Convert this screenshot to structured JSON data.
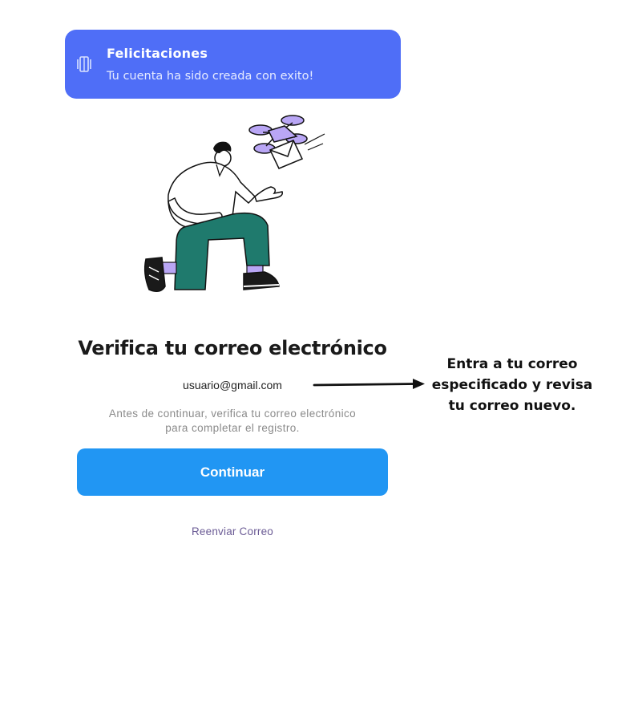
{
  "toast": {
    "icon": "vibrate-icon",
    "title": "Felicitaciones",
    "message": "Tu cuenta ha sido creada con exito!"
  },
  "illustration": {
    "icon": "person-receiving-drone-mail-illustration",
    "colors": {
      "drone": "#b9a6f5",
      "pants": "#1f7a6d",
      "outline": "#111111"
    }
  },
  "main": {
    "title": "Verifica tu correo electrónico",
    "email": "usuario@gmail.com",
    "instructions_line1": "Antes de continuar, verifica tu correo electrónico",
    "instructions_line2": "para completar el registro.",
    "continue_label": "Continuar",
    "resend_label": "Reenviar Correo"
  },
  "annotation": {
    "line1": "Entra a tu correo",
    "line2": "especificado y revisa",
    "line3": "tu correo nuevo."
  },
  "colors": {
    "toast_bg": "#4f6ef7",
    "button_bg": "#2196f3",
    "link": "#6b5b95"
  }
}
